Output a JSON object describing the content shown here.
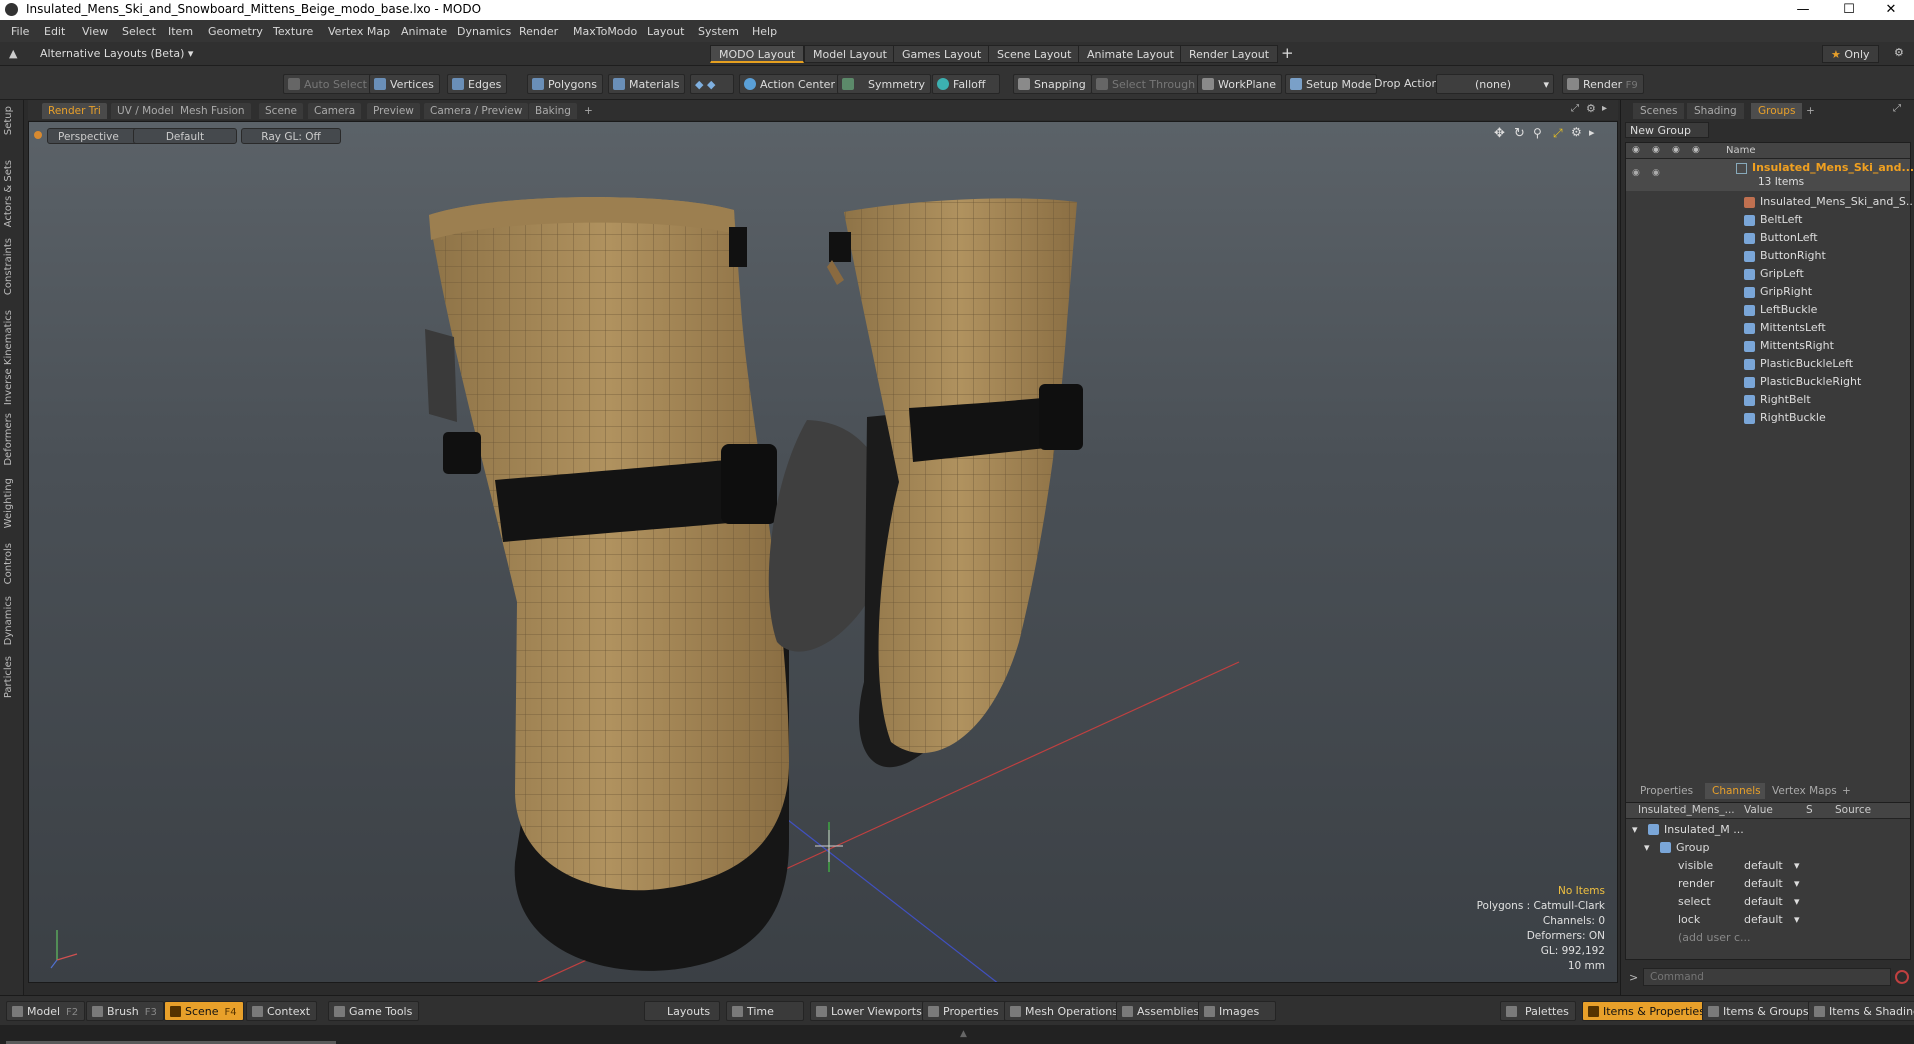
{
  "window": {
    "title": "Insulated_Mens_Ski_and_Snowboard_Mittens_Beige_modo_base.lxo - MODO"
  },
  "menu": [
    "File",
    "Edit",
    "View",
    "Select",
    "Item",
    "Geometry",
    "Texture",
    "Vertex Map",
    "Animate",
    "Dynamics",
    "Render",
    "MaxToModo",
    "Layout",
    "System",
    "Help"
  ],
  "layoutbar": {
    "alt_layouts": "Alternative Layouts (Beta)",
    "tabs": [
      "MODO Layout",
      "Model Layout",
      "Games Layout",
      "Scene Layout",
      "Animate Layout",
      "Render Layout"
    ],
    "plus": "+",
    "only": "Only"
  },
  "toolbar": {
    "auto_select": "Auto Select",
    "vertices": "Vertices",
    "edges": "Edges",
    "polygons": "Polygons",
    "materials": "Materials",
    "action_center": "Action Center",
    "symmetry": "Symmetry",
    "falloff": "Falloff",
    "snapping": "Snapping",
    "select_through": "Select Through",
    "workplane": "WorkPlane",
    "setup_mode": "Setup Mode",
    "drop_action": "Drop Action",
    "drop_value": "(none)",
    "render": "Render",
    "render_key": "F9"
  },
  "lefttabs": [
    "Setup",
    "Actors & Sets",
    "Constraints",
    "Inverse Kinematics",
    "Deformers",
    "Weighting",
    "Controls",
    "Dynamics",
    "Particles"
  ],
  "viewport": {
    "tabs": [
      "Render Tri",
      "UV / Model",
      "Mesh Fusion",
      "Scene",
      "Camera",
      "Preview",
      "Camera / Preview",
      "Baking",
      "+"
    ],
    "perspective": "Perspective",
    "shading": "Default",
    "raygl": "Ray GL: Off",
    "info": {
      "no_items": "No Items",
      "polygons": "Polygons : Catmull-Clark",
      "channels": "Channels: 0",
      "deformers": "Deformers: ON",
      "gl": "GL: 992,192",
      "scale": "10 mm"
    }
  },
  "scene_panel": {
    "tabs": [
      "Scenes",
      "Shading",
      "Groups",
      "+"
    ],
    "new_group": "New Group",
    "col_name": "Name",
    "group_name": "Insulated_Mens_Ski_and...",
    "item_count": "13 Items",
    "items": [
      "Insulated_Mens_Ski_and_S...",
      "BeltLeft",
      "ButtonLeft",
      "ButtonRight",
      "GripLeft",
      "GripRight",
      "LeftBuckle",
      "MittentsLeft",
      "MittentsRight",
      "PlasticBuckleLeft",
      "PlasticBuckleRight",
      "RightBelt",
      "RightBuckle"
    ]
  },
  "channels_panel": {
    "tabs": [
      "Properties",
      "Channels",
      "Vertex Maps",
      "+"
    ],
    "headers": {
      "name": "Insulated_Mens_...",
      "value": "Value",
      "s": "S",
      "source": "Source"
    },
    "root": "Insulated_M ...",
    "group": "Group",
    "rows": [
      {
        "name": "visible",
        "value": "default"
      },
      {
        "name": "render",
        "value": "default"
      },
      {
        "name": "select",
        "value": "default"
      },
      {
        "name": "lock",
        "value": "default"
      }
    ],
    "add_user": "(add user c..."
  },
  "command": {
    "placeholder": "Command"
  },
  "bottombar": {
    "model": "Model",
    "model_key": "F2",
    "brush": "Brush",
    "brush_key": "F3",
    "scene": "Scene",
    "scene_key": "F4",
    "context": "Context",
    "game_tools": "Game Tools",
    "layouts": "Layouts",
    "time": "Time",
    "lower_viewports": "Lower Viewports",
    "properties": "Properties",
    "mesh_operations": "Mesh Operations",
    "assemblies": "Assemblies",
    "images": "Images",
    "palettes": "Palettes",
    "items_properties": "Items & Properties",
    "items_groups": "Items & Groups",
    "items_shading": "Items & Shading"
  },
  "colors": {
    "accent": "#e8a02a",
    "mitten_fabric": "#a8895a",
    "strap": "#111111",
    "panel": "#2d2d2d"
  }
}
